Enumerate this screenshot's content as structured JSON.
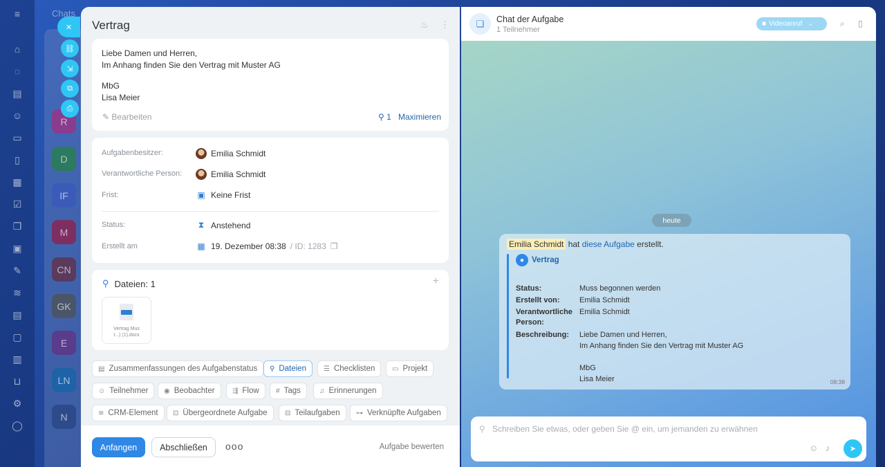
{
  "background": {
    "chats_title": "Chats",
    "chat_avatars": [
      "R",
      "D",
      "IF",
      "M",
      "CN",
      "GK",
      "E",
      "LN",
      "N"
    ],
    "side_actions": [
      "close-icon",
      "link-icon",
      "download-icon",
      "open-icon",
      "print-icon"
    ]
  },
  "task": {
    "title": "Vertrag",
    "description_lines": [
      "Liebe Damen und Herren,",
      "Im Anhang finden Sie den Vertrag mit Muster AG",
      "MbG",
      "Lisa Meier"
    ],
    "edit_label": "Bearbeiten",
    "attachment_count": "1",
    "maximize_label": "Maximieren",
    "owner_label": "Aufgabenbesitzer:",
    "owner_value": "Emilia Schmidt",
    "responsible_label": "Verantwortliche Person:",
    "responsible_value": "Emilia Schmidt",
    "deadline_label": "Frist:",
    "deadline_value": "Keine Frist",
    "status_label": "Status:",
    "status_value": "Anstehend",
    "created_label": "Erstellt am",
    "created_value": "19. Dezember 08:38",
    "id_text": "/ ID: 1283",
    "files_title": "Dateien: 1",
    "file_name_1": "Vertrag Mus",
    "file_name_2": "t...) (1).docx"
  },
  "chips": [
    "Zusammenfassungen des Aufgabenstatus",
    "Dateien",
    "Checklisten",
    "Projekt",
    "Teilnehmer",
    "Beobachter",
    "Flow",
    "Tags",
    "Erinnerungen",
    "CRM-Element",
    "Übergeordnete Aufgabe",
    "Teilaufgaben",
    "Verknüpfte Aufgaben"
  ],
  "footer": {
    "start": "Anfangen",
    "finish": "Abschließen",
    "more": "ooo",
    "rate": "Aufgabe bewerten"
  },
  "chat": {
    "title": "Chat der Aufgabe",
    "subtitle": "1 Teilnehmer",
    "video_label": "Videoanruf",
    "date_badge": "heute",
    "msg_author": "Emilia Schmidt",
    "msg_mid": "hat",
    "msg_link": "diese Aufgabe",
    "msg_end": "erstellt.",
    "card_title": "Vertrag",
    "status_k": "Status:",
    "status_v": "Muss begonnen werden",
    "created_k": "Erstellt von:",
    "created_v": "Emilia Schmidt",
    "resp_k1": "Verantwortliche",
    "resp_k2": "Person:",
    "resp_v": "Emilia Schmidt",
    "desc_k": "Beschreibung:",
    "desc_v1": "Liebe Damen und Herren,",
    "desc_v2": "Im Anhang finden Sie den Vertrag mit Muster AG",
    "desc_v3": "MbG",
    "desc_v4": "Lisa Meier",
    "time": "08:38",
    "input_placeholder": "Schreiben Sie etwas, oder geben Sie @ ein, um jemanden zu erwähnen"
  }
}
